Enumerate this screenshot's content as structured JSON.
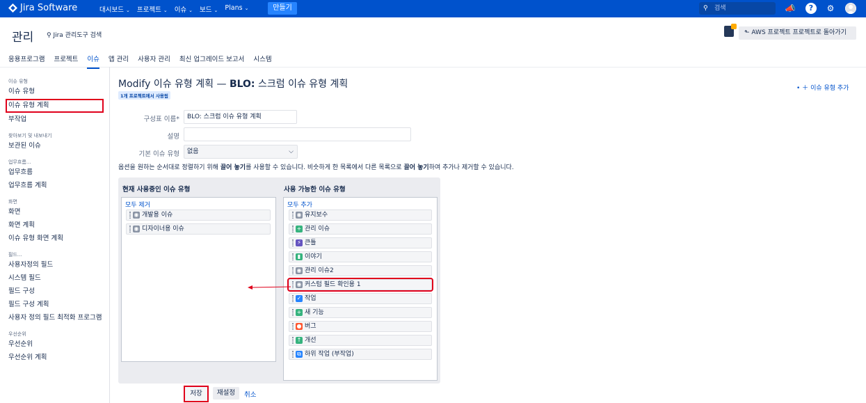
{
  "topbar": {
    "logo": "Jira Software",
    "nav": [
      {
        "label": "대시보드",
        "chevron": true
      },
      {
        "label": "프로젝트",
        "chevron": true
      },
      {
        "label": "이슈",
        "chevron": true
      },
      {
        "label": "보드",
        "chevron": true
      },
      {
        "label": "Plans",
        "chevron": true
      }
    ],
    "create_label": "만들기",
    "search_placeholder": "검색"
  },
  "admin": {
    "title": "관리",
    "search_label": "Jira 관리도구 검색",
    "back_button": "AWS 프로젝트 프로젝트로 돌아가기"
  },
  "tabs": [
    {
      "label": "응용프로그램",
      "active": false
    },
    {
      "label": "프로젝트",
      "active": false
    },
    {
      "label": "이슈",
      "active": true
    },
    {
      "label": "앱 관리",
      "active": false
    },
    {
      "label": "사용자 관리",
      "active": false
    },
    {
      "label": "최신 업그레이드 보고서",
      "active": false
    },
    {
      "label": "시스템",
      "active": false
    }
  ],
  "sidebar": {
    "groups": [
      {
        "title": "이슈 유형",
        "items": [
          {
            "label": "이슈 유형"
          },
          {
            "label": "이슈 유형 계획",
            "highlight": true
          },
          {
            "label": "부작업"
          }
        ]
      },
      {
        "title": "찾아보기 및 내보내기",
        "items": [
          {
            "label": "보관된 이슈"
          }
        ]
      },
      {
        "title": "업무흐름...",
        "items": [
          {
            "label": "업무흐름"
          },
          {
            "label": "업무흐름 계획"
          }
        ]
      },
      {
        "title": "화면",
        "items": [
          {
            "label": "화면"
          },
          {
            "label": "화면 계획"
          },
          {
            "label": "이슈 유형 화면 계획"
          }
        ]
      },
      {
        "title": "필드...",
        "items": [
          {
            "label": "사용자정의 필드"
          },
          {
            "label": "시스템 필드"
          },
          {
            "label": "필드 구성"
          },
          {
            "label": "필드 구성 계획"
          },
          {
            "label": "사용자 정의 필드 최적화 프로그램"
          }
        ]
      },
      {
        "title": "우선순위",
        "items": [
          {
            "label": "우선순위"
          },
          {
            "label": "우선순위 계획"
          }
        ]
      }
    ]
  },
  "page": {
    "title_prefix": "Modify",
    "title_mid": "이슈 유형 계획 —",
    "title_key": "BLO:",
    "title_suffix": "스크럼 이슈 유형 계획",
    "lozenge": "1개 프로젝트에서 사용됨",
    "add_issue_type": "이슈 유형 추가"
  },
  "form": {
    "scheme_name_label": "구성표 이름*",
    "scheme_name_value": "BLO: 스크럼 이슈 유형 계획",
    "description_label": "설명",
    "description_value": "",
    "default_type_label": "기본 이슈 유형",
    "default_type_value": "없음"
  },
  "instruction": {
    "part1": "옵션을 원하는 순서대로 정렬하기 위해",
    "bold1": "끌어 놓기",
    "part2": "를 사용할 수 있습니다. 비슷하게 한 목록에서 다른 목록으로",
    "bold2": "끌어 놓기",
    "part3": "하여 추가나 제거할 수 있습니다."
  },
  "current": {
    "title": "현재 사용중인 이슈 유형",
    "remove_all": "모두 제거",
    "items": [
      {
        "label": "개발용 이슈",
        "icon": "gray-circle-icon",
        "color": "#8993a4"
      },
      {
        "label": "디자이너용 이슈",
        "icon": "gray-circle-icon",
        "color": "#8993a4"
      }
    ]
  },
  "available": {
    "title": "사용 가능한 이슈 유형",
    "add_all": "모두 추가",
    "items": [
      {
        "label": "유지보수",
        "icon": "gray-circle-icon",
        "color": "#8993a4"
      },
      {
        "label": "관리 이슈",
        "icon": "plus-icon",
        "color": "#36b37e"
      },
      {
        "label": "큰틀",
        "icon": "lightning-icon",
        "color": "#6554c0"
      },
      {
        "label": "이야기",
        "icon": "bookmark-icon",
        "color": "#36b37e"
      },
      {
        "label": "관리 이슈2",
        "icon": "gray-circle-icon",
        "color": "#8993a4"
      },
      {
        "label": "커스텀 필드 확인용 1",
        "icon": "gray-circle-icon",
        "color": "#8993a4",
        "highlight": true
      },
      {
        "label": "작업",
        "icon": "check-icon",
        "color": "#2684ff"
      },
      {
        "label": "새 기능",
        "icon": "plus-icon",
        "color": "#36b37e"
      },
      {
        "label": "버그",
        "icon": "bug-icon",
        "color": "#ff5630"
      },
      {
        "label": "개선",
        "icon": "arrow-up-icon",
        "color": "#36b37e"
      },
      {
        "label": "하위 작업 (부작업)",
        "icon": "subtask-icon",
        "color": "#2684ff"
      }
    ]
  },
  "buttons": {
    "save": "저장",
    "reset": "재설정",
    "cancel": "취소"
  }
}
